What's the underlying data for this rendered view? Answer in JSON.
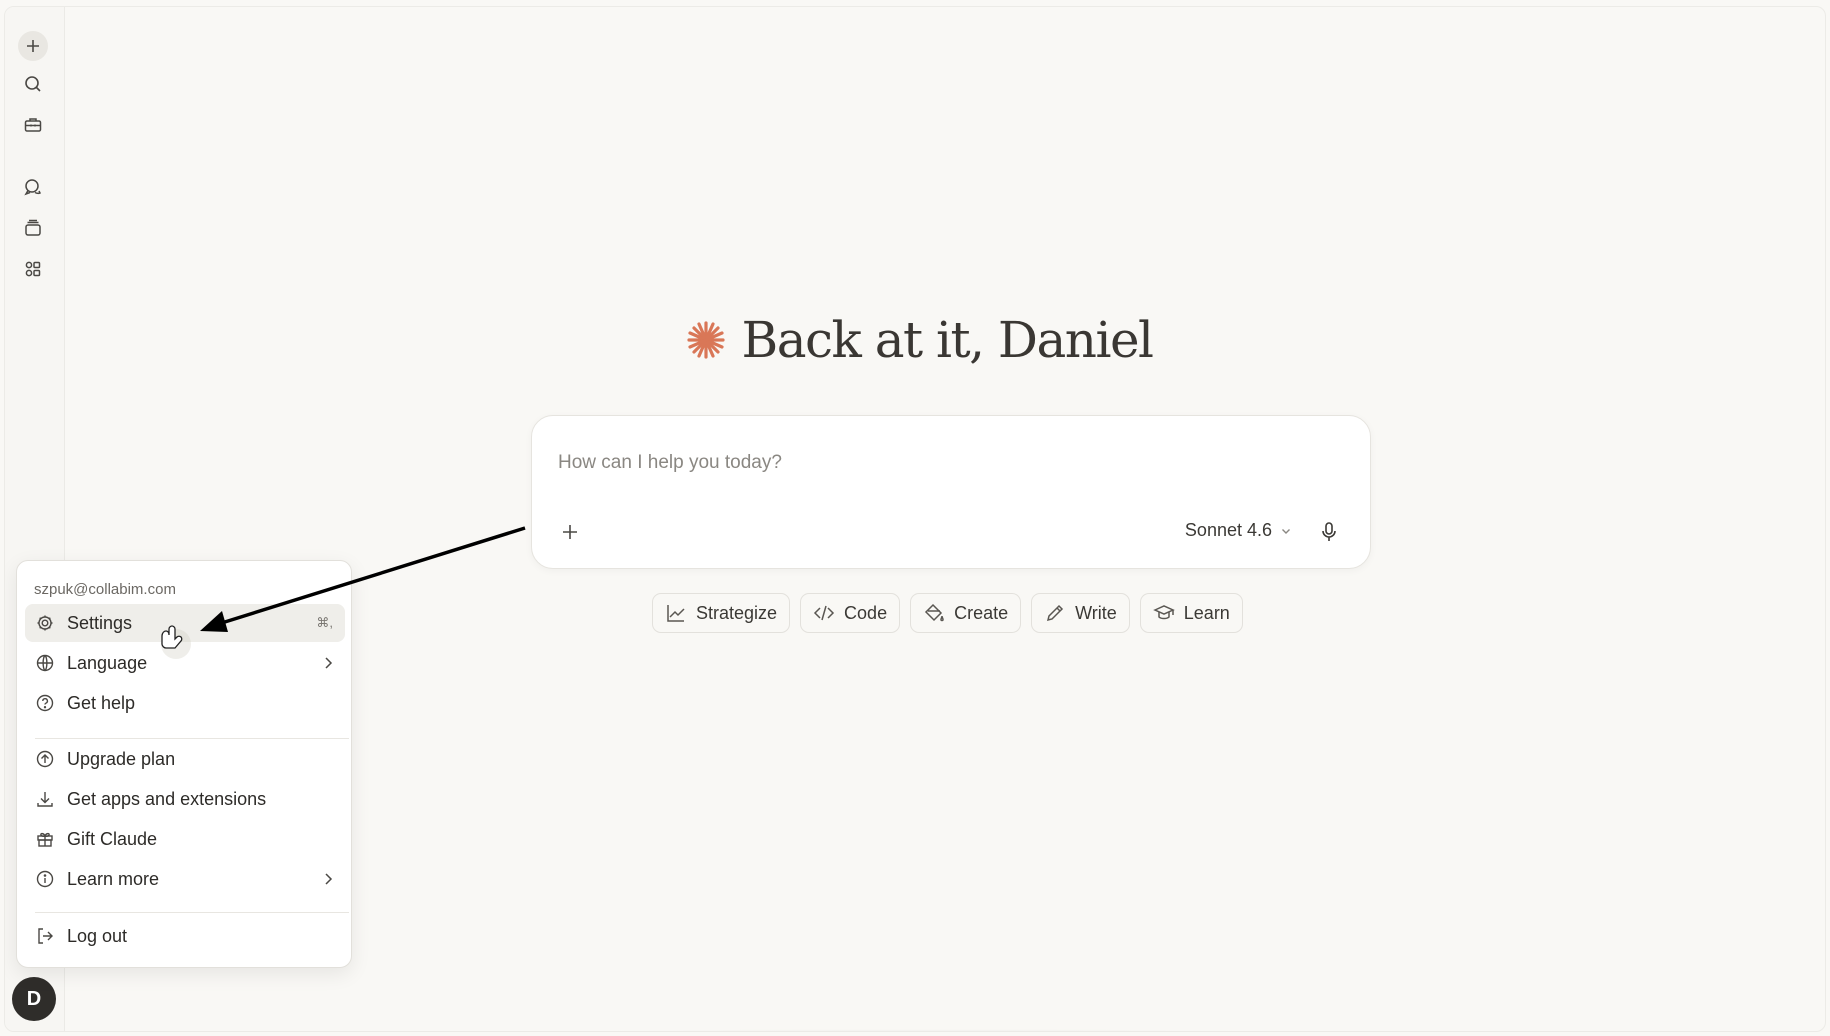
{
  "greeting": {
    "text": "Back at it, Daniel"
  },
  "composer": {
    "placeholder": "How can I help you today?",
    "model": "Sonnet 4.6"
  },
  "chips": [
    {
      "label": "Strategize",
      "icon": "chart-line-icon"
    },
    {
      "label": "Code",
      "icon": "code-icon"
    },
    {
      "label": "Create",
      "icon": "paint-bucket-icon"
    },
    {
      "label": "Write",
      "icon": "pencil-icon"
    },
    {
      "label": "Learn",
      "icon": "graduation-cap-icon"
    }
  ],
  "sidebar": {
    "items": [
      "new-chat-icon",
      "search-icon",
      "toolbox-icon",
      "chats-icon",
      "projects-icon",
      "artifacts-icon"
    ],
    "avatar_initial": "D"
  },
  "menu": {
    "email": "szpuk@collabim.com",
    "items": [
      {
        "label": "Settings",
        "shortcut": "⌘,",
        "icon": "gear-icon"
      },
      {
        "label": "Language",
        "icon": "globe-icon",
        "submenu": true
      },
      {
        "label": "Get help",
        "icon": "help-circle-icon"
      },
      {
        "label": "Upgrade plan",
        "icon": "upgrade-icon"
      },
      {
        "label": "Get apps and extensions",
        "icon": "download-icon"
      },
      {
        "label": "Gift Claude",
        "icon": "gift-icon"
      },
      {
        "label": "Learn more",
        "icon": "info-icon",
        "submenu": true
      },
      {
        "label": "Log out",
        "icon": "logout-icon"
      }
    ]
  },
  "colors": {
    "accent": "#d97757",
    "background": "#f9f8f5",
    "avatar": "#2f2d2a"
  }
}
